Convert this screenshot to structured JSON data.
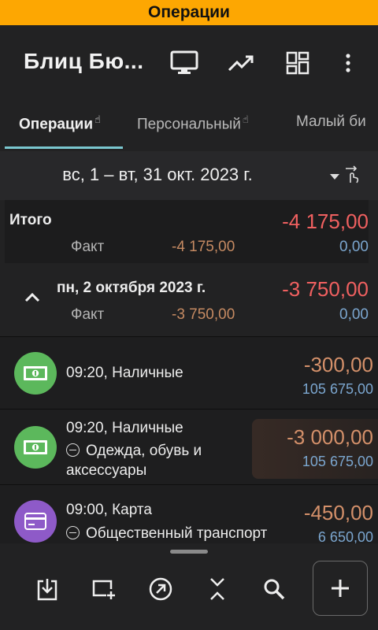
{
  "banner": "Операции",
  "app": {
    "title": "Блиц Бю...",
    "icons": [
      "monitor-icon",
      "trending-up-icon",
      "dashboard-grid-icon",
      "more-vertical-icon"
    ]
  },
  "tabs": [
    {
      "label": "Операции",
      "active": true
    },
    {
      "label": "Персональный",
      "active": false
    },
    {
      "label": "Малый би",
      "active": false
    }
  ],
  "period": {
    "text": "вс, 1 – вт, 31 окт. 2023 г.",
    "icons": [
      "dropdown-arrow-icon",
      "swipe-hand-icon"
    ]
  },
  "total": {
    "label": "Итого",
    "amount": "-4 175,00",
    "fact_label": "Факт",
    "fact_value": "-4 175,00",
    "plan_value": "0,00"
  },
  "day": {
    "label": "пн, 2 октября 2023 г.",
    "amount": "-3 750,00",
    "fact_label": "Факт",
    "fact_value": "-3 750,00",
    "plan_value": "0,00"
  },
  "transactions": [
    {
      "line1": "09:20, Наличные",
      "line2": "",
      "line3": "",
      "amount": "-300,00",
      "balance": "105 675,00",
      "icon": "cash-icon",
      "color": "#5cb85c"
    },
    {
      "line1": "09:20, Наличные",
      "line2": "Одежда, обувь и",
      "line3": "аксессуары",
      "amount": "-3 000,00",
      "balance": "105 675,00",
      "icon": "cash-icon",
      "color": "#5cb85c"
    },
    {
      "line1": "09:00, Карта",
      "line2": "Общественный транспорт",
      "line3": "",
      "amount": "-450,00",
      "balance": "6 650,00",
      "icon": "credit-card-icon",
      "color": "#8e5ac8"
    }
  ],
  "bottom_icons": [
    "import-icon",
    "add-window-icon",
    "open-arrow-icon",
    "collapse-icon",
    "search-icon",
    "add-icon"
  ],
  "colors": {
    "banner": "#fda702",
    "negative": "#f06060",
    "fact": "#c58a62",
    "plan": "#7ba6cf",
    "tab_indicator": "#7ac7cf"
  }
}
